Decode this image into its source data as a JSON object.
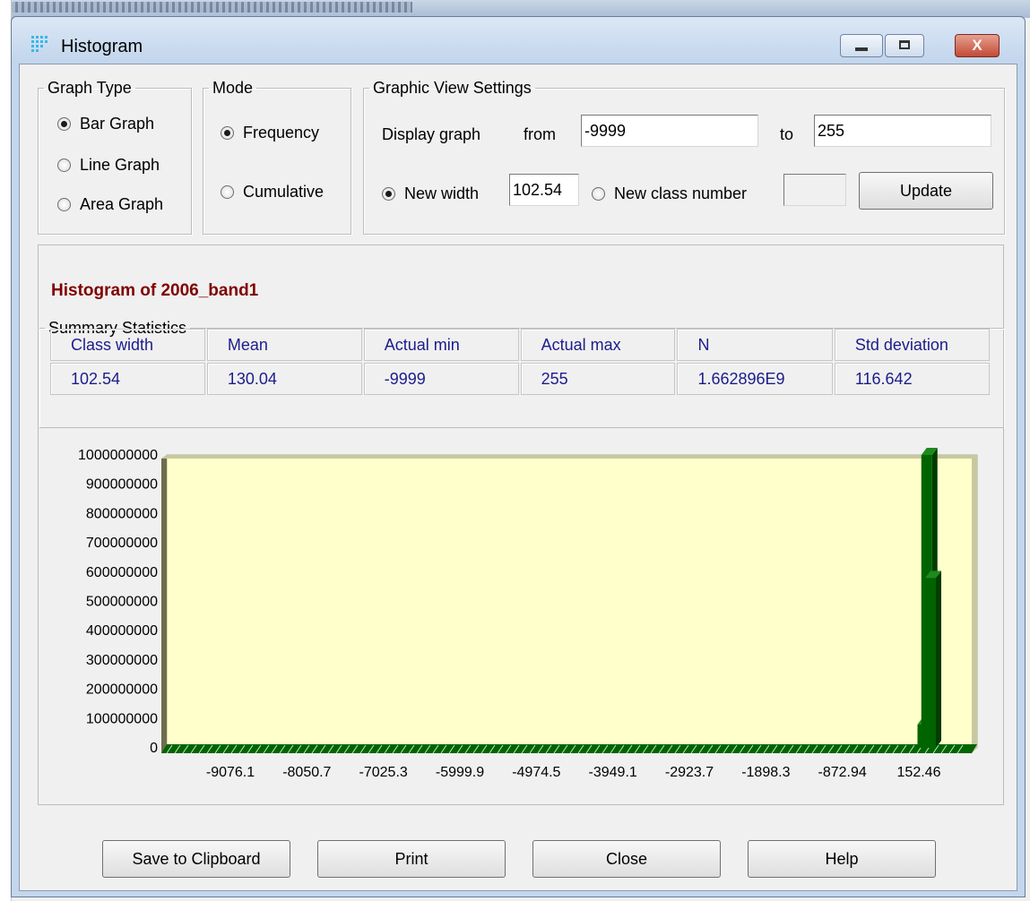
{
  "window": {
    "title": "Histogram",
    "min_glyph": "",
    "max_glyph": "",
    "close_glyph": "X"
  },
  "graph_type": {
    "legend": "Graph Type",
    "options": [
      "Bar Graph",
      "Line Graph",
      "Area Graph"
    ],
    "selected": "Bar Graph"
  },
  "mode": {
    "legend": "Mode",
    "options": [
      "Frequency",
      "Cumulative"
    ],
    "selected": "Frequency"
  },
  "view_settings": {
    "legend": "Graphic View Settings",
    "display_label": "Display graph",
    "from_label": "from",
    "from_value": "-9999",
    "to_label": "to",
    "to_value": "255",
    "new_width_label": "New width",
    "new_width_value": "102.54",
    "new_class_label": "New class number",
    "new_class_value": "",
    "update_label": "Update",
    "selected": "New width"
  },
  "histogram_title": "Histogram of 2006_band1",
  "summary": {
    "legend": "Summary Statistics",
    "headers": [
      "Class width",
      "Mean",
      "Actual min",
      "Actual max",
      "N",
      "Std deviation"
    ],
    "values": [
      "102.54",
      "130.04",
      "-9999",
      "255",
      "1.662896E9",
      "116.642"
    ]
  },
  "chart_data": {
    "type": "bar",
    "y_ticks": [
      "0",
      "100000000",
      "200000000",
      "300000000",
      "400000000",
      "500000000",
      "600000000",
      "700000000",
      "800000000",
      "900000000",
      "1000000000"
    ],
    "x_ticks": [
      "-9076.1",
      "-8050.7",
      "-7025.3",
      "-5999.9",
      "-4974.5",
      "-3949.1",
      "-2923.7",
      "-1898.3",
      "-872.94",
      "152.46"
    ],
    "ylim": [
      0,
      1000000000
    ],
    "bars": [
      {
        "x": 50.2,
        "value": 80000000
      },
      {
        "x": 101.5,
        "value": 1050000000
      },
      {
        "x": 152.46,
        "value": 580000000
      }
    ],
    "colors": {
      "bar": "#006400",
      "plot_bg": "#ffffcc",
      "frame": "#c8c8a0"
    },
    "grid": false,
    "legend": "none"
  },
  "buttons": {
    "save": "Save to Clipboard",
    "print": "Print",
    "close": "Close",
    "help": "Help"
  }
}
